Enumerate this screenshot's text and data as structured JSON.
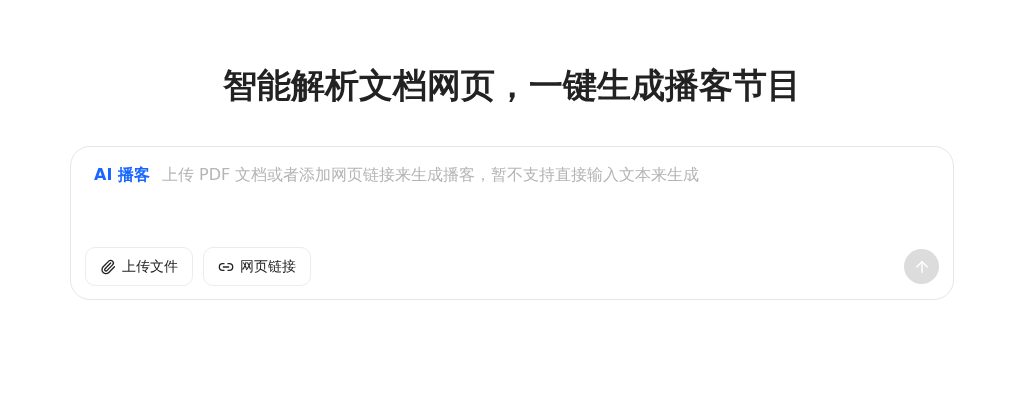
{
  "heading": "智能解析文档网页，一键生成播客节目",
  "composer": {
    "tag": "AI 播客",
    "placeholder": "上传 PDF 文档或者添加网页链接来生成播客，暂不支持直接输入文本来生成",
    "actions": [
      {
        "kind": "upload",
        "label": "上传文件"
      },
      {
        "kind": "link",
        "label": "网页链接"
      }
    ],
    "send": {
      "disabled": true
    }
  }
}
